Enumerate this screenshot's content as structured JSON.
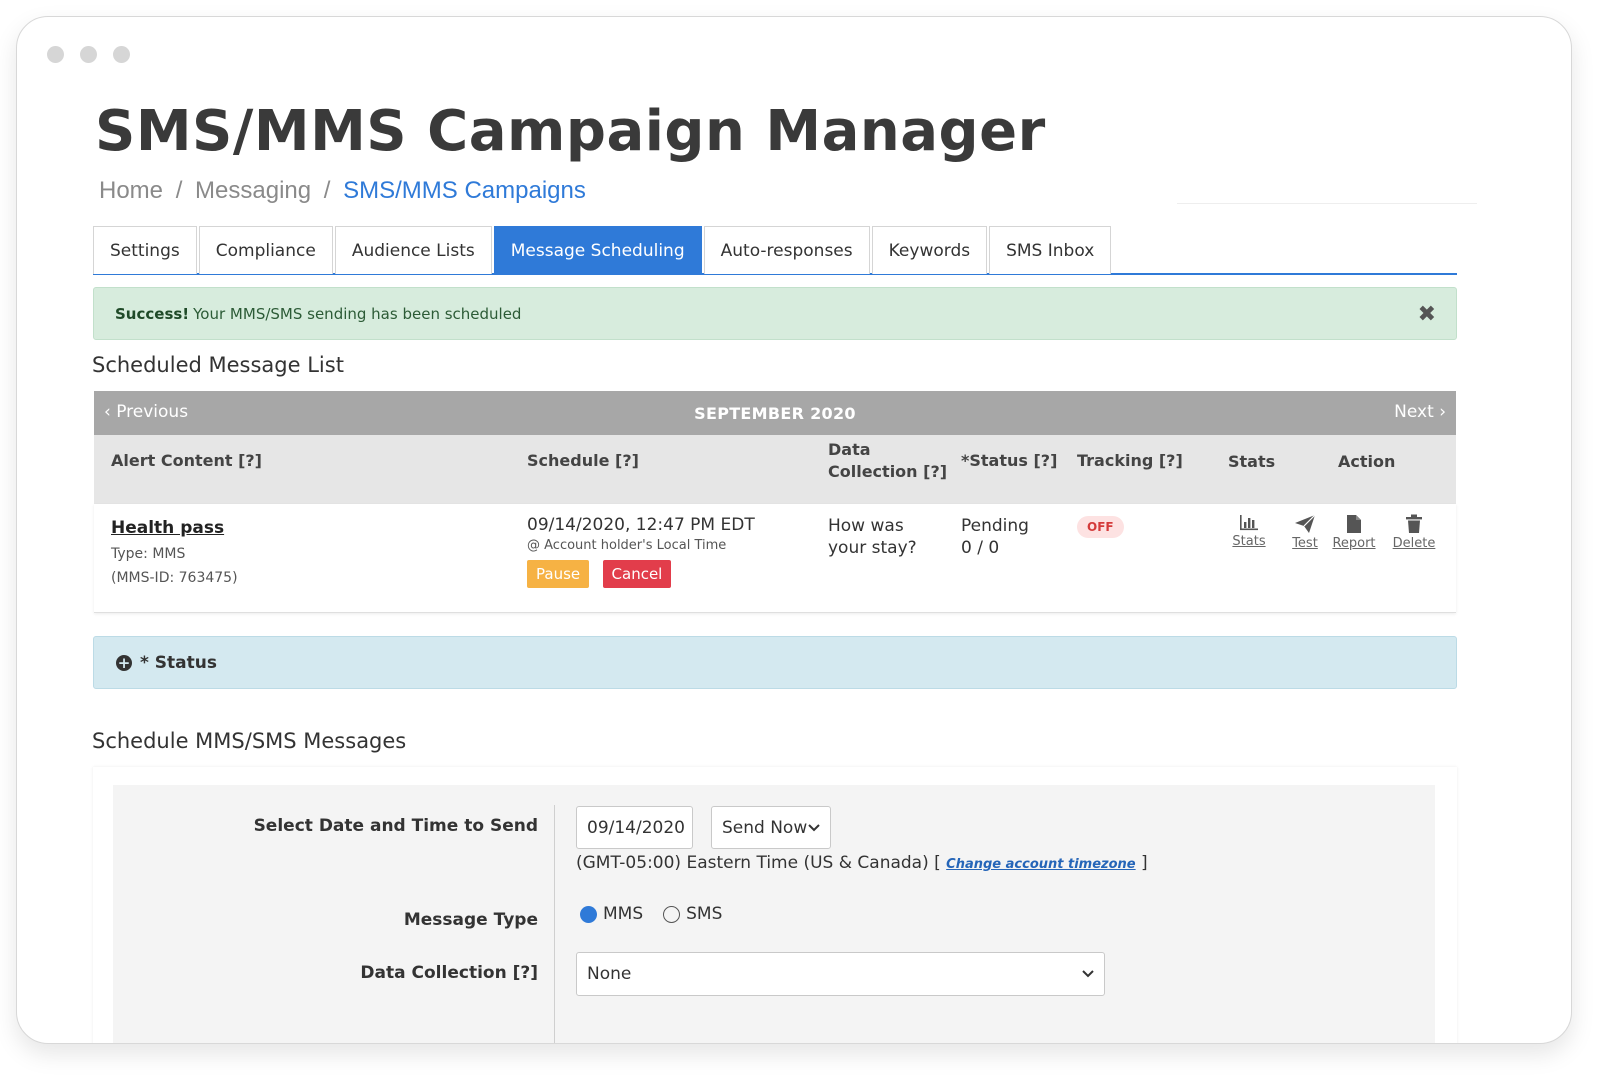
{
  "page": {
    "title": "SMS/MMS Campaign Manager",
    "breadcrumb": {
      "home": "Home",
      "sep": "/",
      "messaging": "Messaging",
      "current": "SMS/MMS Campaigns"
    }
  },
  "tabs": [
    {
      "label": "Settings",
      "active": false
    },
    {
      "label": "Compliance",
      "active": false
    },
    {
      "label": "Audience Lists",
      "active": false
    },
    {
      "label": "Message Scheduling",
      "active": true
    },
    {
      "label": "Auto-responses",
      "active": false
    },
    {
      "label": "Keywords",
      "active": false
    },
    {
      "label": "SMS Inbox",
      "active": false
    }
  ],
  "alert": {
    "strong": "Success!",
    "message": "Your MMS/SMS sending has been scheduled",
    "close_icon": "close-x-icon"
  },
  "list": {
    "heading": "Scheduled Message List",
    "month_nav": {
      "prev": "Previous",
      "month": "SEPTEMBER 2020",
      "next": "Next"
    },
    "columns": {
      "alert_content": "Alert Content [?]",
      "schedule": "Schedule [?]",
      "data_collection_1": "Data",
      "data_collection_2": "Collection [?]",
      "status": "*Status [?]",
      "tracking": "Tracking [?]",
      "stats": "Stats",
      "action": "Action"
    },
    "row": {
      "title": "Health pass",
      "type": "Type: MMS",
      "id": "(MMS-ID: 763475)",
      "schedule_time": "09/14/2020, 12:47 PM EDT",
      "schedule_note": "@ Account holder's Local Time",
      "pause": "Pause",
      "cancel": "Cancel",
      "data_collection_1": "How was",
      "data_collection_2": "your stay?",
      "status": "Pending",
      "status_count": "0 / 0",
      "tracking": "OFF",
      "actions": {
        "stats": "Stats",
        "test": "Test",
        "report": "Report",
        "delete": "Delete"
      }
    }
  },
  "status_panel": {
    "label": "* Status",
    "icon": "plus-circle-icon"
  },
  "schedule_form": {
    "heading": "Schedule MMS/SMS Messages",
    "date_label": "Select Date and Time to Send",
    "date_value": "09/14/2020",
    "send_option": "Send Now",
    "timezone": "(GMT-05:00) Eastern Time (US & Canada) [",
    "timezone_link": "Change account timezone",
    "timezone_end": "]",
    "message_type_label": "Message Type",
    "message_type_options": [
      "MMS",
      "SMS"
    ],
    "message_type_selected": "MMS",
    "data_collection_label": "Data Collection [?]",
    "data_collection_value": "None"
  },
  "colors": {
    "accent": "#2f7ad8",
    "success_bg": "#d7ecdd",
    "info_bg": "#d4e9f0",
    "pause": "#f6b244",
    "cancel": "#e23d4b"
  }
}
